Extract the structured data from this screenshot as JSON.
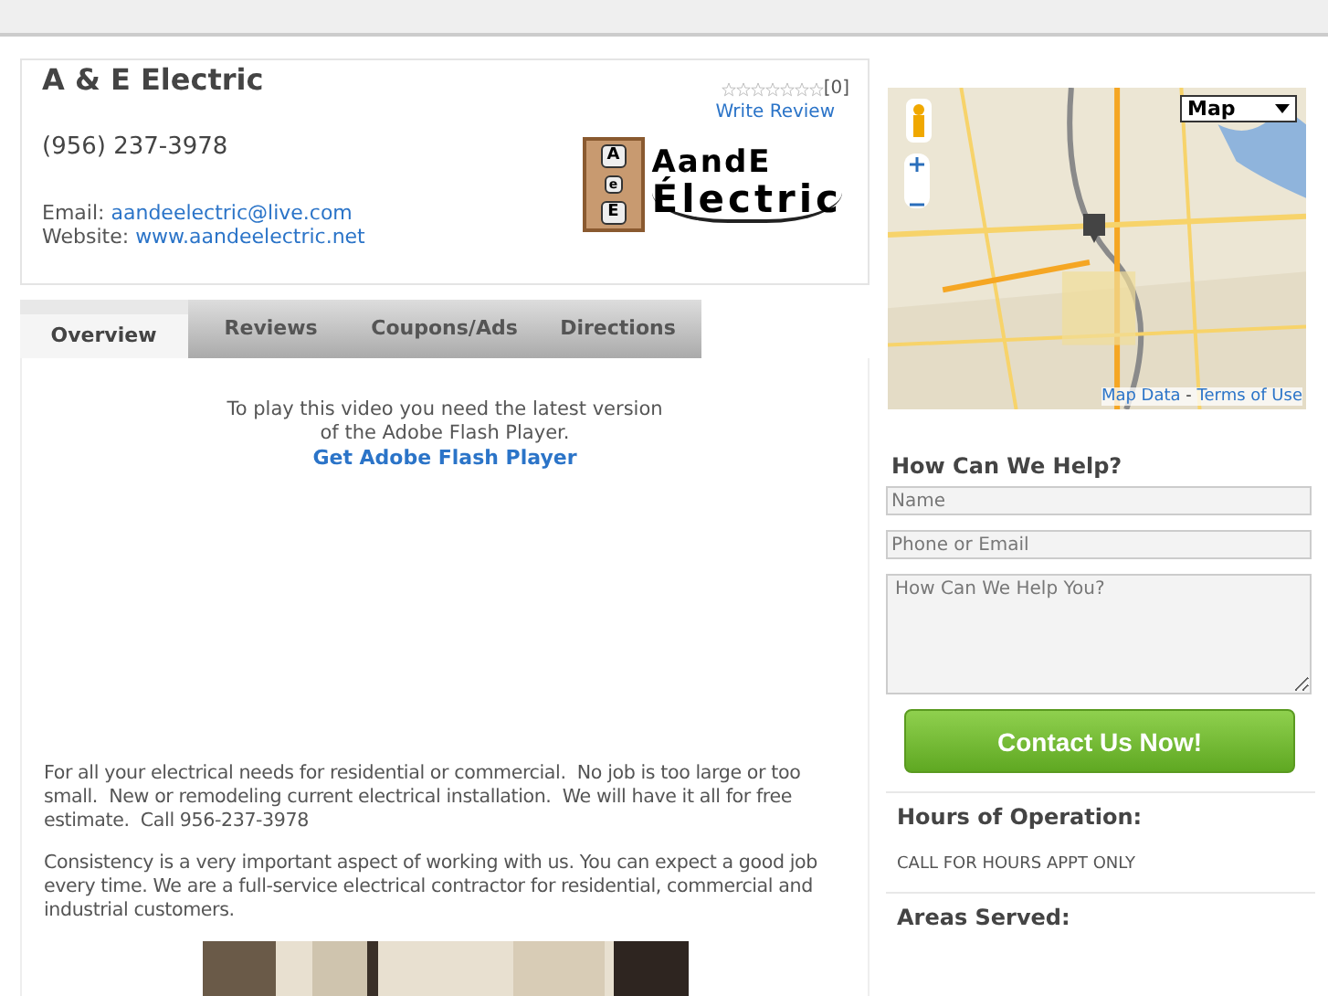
{
  "business": {
    "name": "A & E Electric",
    "phone": "(956) 237-3978",
    "email_label": "Email:",
    "email": "aandeelectric@live.com",
    "website_label": "Website:",
    "website": "www.aandeelectric.net"
  },
  "rating": {
    "stars": 0,
    "count": "[0]",
    "write_review": "Write Review"
  },
  "logo": {
    "letters": [
      "A",
      "e",
      "E"
    ],
    "line1": "AandE",
    "line2": "Électric"
  },
  "tabs": [
    {
      "label": "Overview",
      "selected": true
    },
    {
      "label": "Reviews",
      "selected": false
    },
    {
      "label": "Coupons/Ads",
      "selected": false
    },
    {
      "label": "Directions",
      "selected": false
    }
  ],
  "flash": {
    "message": "To play this video you need the latest version of the Adobe Flash Player.",
    "link": "Get Adobe Flash Player"
  },
  "paragraphs": [
    "For all your electrical needs for residential or commercial.  No job is too large or too small.  New or remodeling current electrical installation.  We will have it all for free estimate.  Call 956-237-3978",
    "Consistency is a very important aspect of working with us. You can expect a good job every time. We are a full-service electrical contractor for residential, commercial and industrial customers."
  ],
  "map": {
    "kind": "picture",
    "type_select": "Map",
    "map_data": "Map Data",
    "separator": "-",
    "terms": "Terms of Use"
  },
  "contact": {
    "title": "How Can We Help?",
    "fields": [
      {
        "kind": "input",
        "placeholder": "Name"
      },
      {
        "kind": "input",
        "placeholder": "Phone or Email"
      },
      {
        "kind": "textarea",
        "placeholder": "How Can We Help You?"
      }
    ],
    "button": "Contact Us Now!"
  },
  "hours": {
    "title": "Hours of Operation:",
    "text": "CALL FOR HOURS APPT ONLY"
  },
  "areas": {
    "title": "Areas Served:"
  }
}
